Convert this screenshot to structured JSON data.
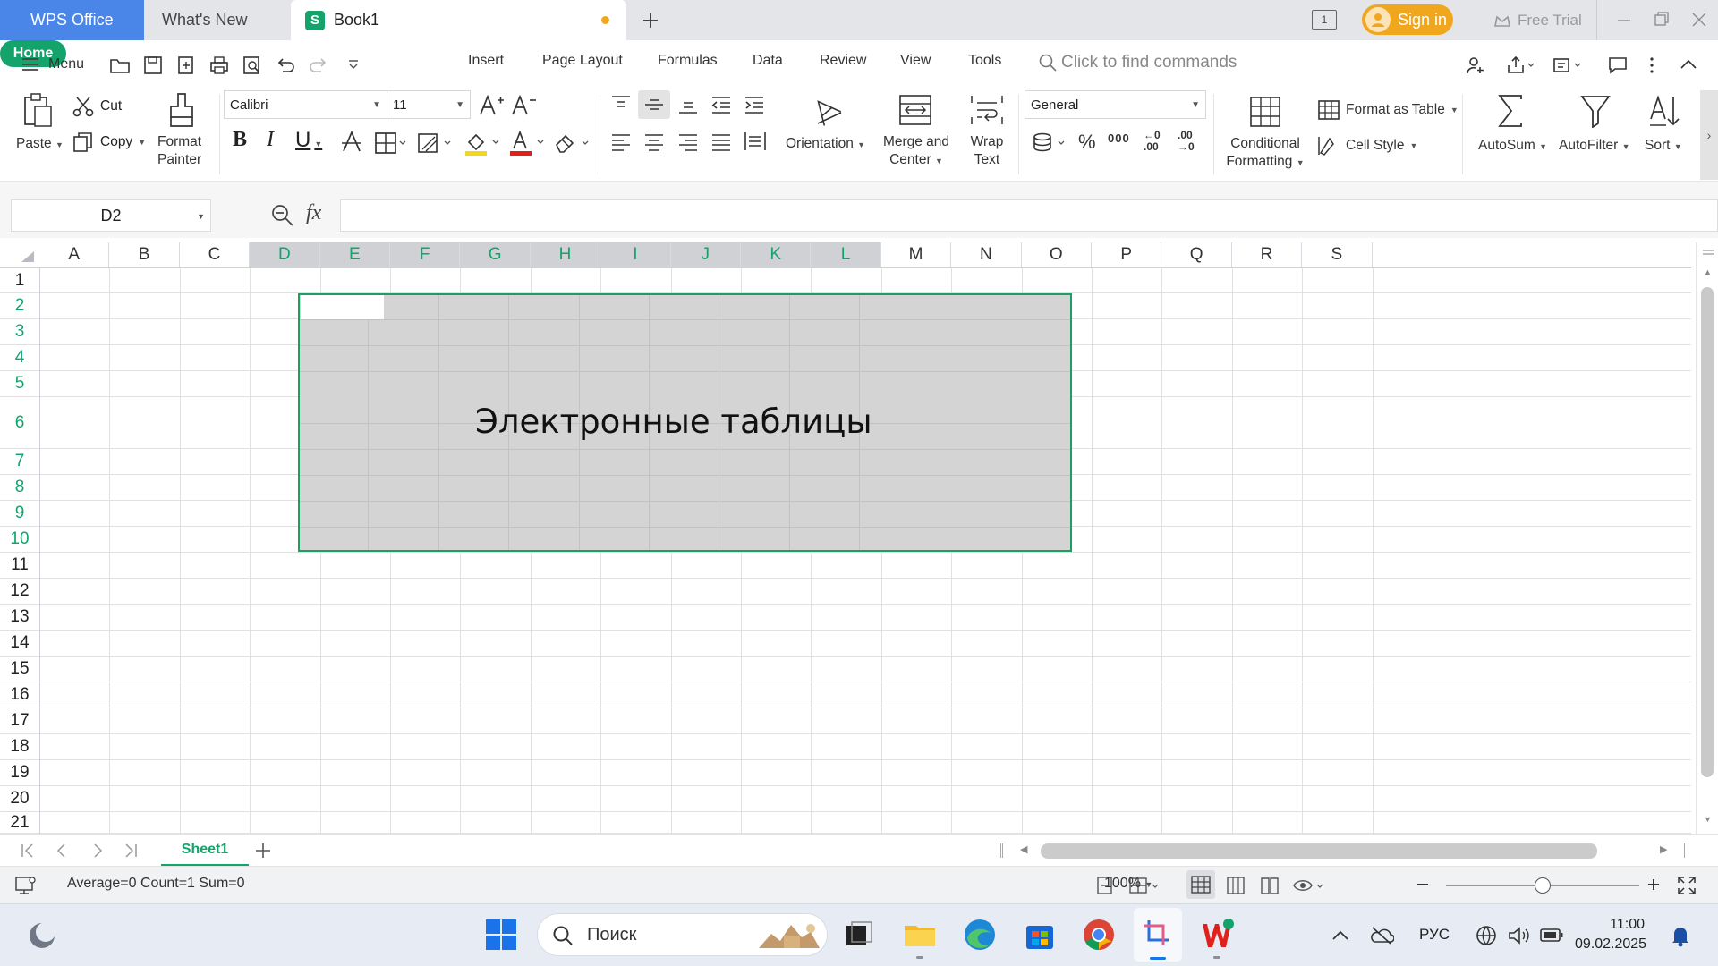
{
  "titlebar": {
    "tabs": [
      {
        "label": "WPS Office"
      },
      {
        "label": "What's New"
      },
      {
        "label": "Book1",
        "app_icon": "S"
      }
    ],
    "sign_in": "Sign in",
    "free_trial": "Free Trial",
    "page_count": "1",
    "accent": "#4a86e8"
  },
  "menubar": {
    "menu": "Menu",
    "tabs": [
      "Home",
      "Insert",
      "Page Layout",
      "Formulas",
      "Data",
      "Review",
      "View",
      "Tools"
    ],
    "active_tab": "Home",
    "search_placeholder": "Click to find commands",
    "accent": "#13a36b"
  },
  "ribbon": {
    "paste": "Paste",
    "cut": "Cut",
    "copy": "Copy",
    "format_painter_1": "Format",
    "format_painter_2": "Painter",
    "font_name": "Calibri",
    "font_size": "11",
    "orientation": "Orientation",
    "merge_1": "Merge and",
    "merge_2": "Center",
    "wrap_1": "Wrap",
    "wrap_2": "Text",
    "number_format": "General",
    "conditional_1": "Conditional",
    "conditional_2": "Formatting",
    "format_as_table": "Format as Table",
    "cell_style": "Cell Style",
    "autosum": "AutoSum",
    "autofilter": "AutoFilter",
    "sort": "Sort",
    "pct": "%",
    "thousands": "000",
    "dec_inc": "←0 .00",
    "dec_dec": ".00 →0"
  },
  "formula_bar": {
    "name_box": "D2",
    "fx": "fx",
    "value": ""
  },
  "sheet": {
    "columns": [
      "A",
      "B",
      "C",
      "D",
      "E",
      "F",
      "G",
      "H",
      "I",
      "J",
      "K",
      "L",
      "M",
      "N",
      "O",
      "P",
      "Q",
      "R",
      "S"
    ],
    "selected_columns": [
      "D",
      "E",
      "F",
      "G",
      "H",
      "I",
      "J",
      "K",
      "L"
    ],
    "rows": [
      "1",
      "2",
      "3",
      "4",
      "5",
      "6",
      "7",
      "8",
      "9",
      "10",
      "11",
      "12",
      "13",
      "14",
      "15",
      "16",
      "17",
      "18",
      "19",
      "20",
      "21"
    ],
    "selected_rows": [
      "2",
      "3",
      "4",
      "5",
      "6",
      "7",
      "8",
      "9",
      "10"
    ],
    "selection_range": "D2:L10",
    "merged_text": "Электронные таблицы",
    "selection_color": "#1f9e64"
  },
  "sheet_tabs": {
    "active": "Sheet1"
  },
  "statusbar": {
    "stats": "Average=0  Count=1  Sum=0",
    "zoom": "100%",
    "zoom_level": 1.0
  },
  "taskbar": {
    "search_placeholder": "Поиск",
    "lang": "РУС",
    "time": "11:00",
    "date": "09.02.2025"
  }
}
